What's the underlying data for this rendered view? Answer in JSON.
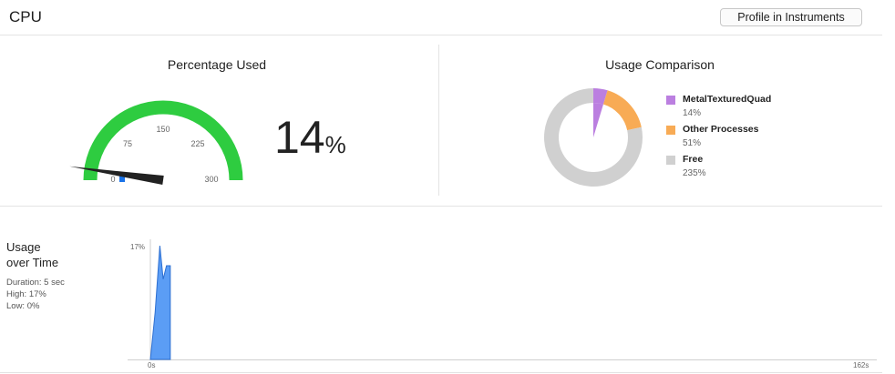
{
  "header": {
    "title": "CPU",
    "profile_button": "Profile in Instruments"
  },
  "percentage_used": {
    "title": "Percentage Used",
    "gauge": {
      "min": 0,
      "max": 300,
      "value": 14,
      "ticks": [
        "0",
        "75",
        "150",
        "225",
        "300"
      ]
    },
    "value_number": "14",
    "value_unit": "%",
    "colors": {
      "arc": "#2ecc40",
      "needle": "#222222",
      "marker": "#1a73e8"
    }
  },
  "usage_comparison": {
    "title": "Usage Comparison",
    "items": [
      {
        "label": "MetalTexturedQuad",
        "value": "14%",
        "amount": 14,
        "color": "#bb7fe0"
      },
      {
        "label": "Other Processes",
        "value": "51%",
        "amount": 51,
        "color": "#f8ab55"
      },
      {
        "label": "Free",
        "value": "235%",
        "amount": 235,
        "color": "#d0d0d0"
      }
    ]
  },
  "usage_over_time": {
    "title_line1": "Usage",
    "title_line2": "over Time",
    "duration": "Duration: 5 sec",
    "high": "High: 17%",
    "low": "Low: 0%",
    "y_max_label": "17%",
    "x_start_label": "0s",
    "x_end_label": "162s",
    "series": {
      "x": [
        0,
        1,
        2,
        2.7,
        3.4,
        4.2
      ],
      "y": [
        0,
        7,
        17,
        12,
        14,
        14
      ]
    },
    "color": "#5b9df5"
  }
}
